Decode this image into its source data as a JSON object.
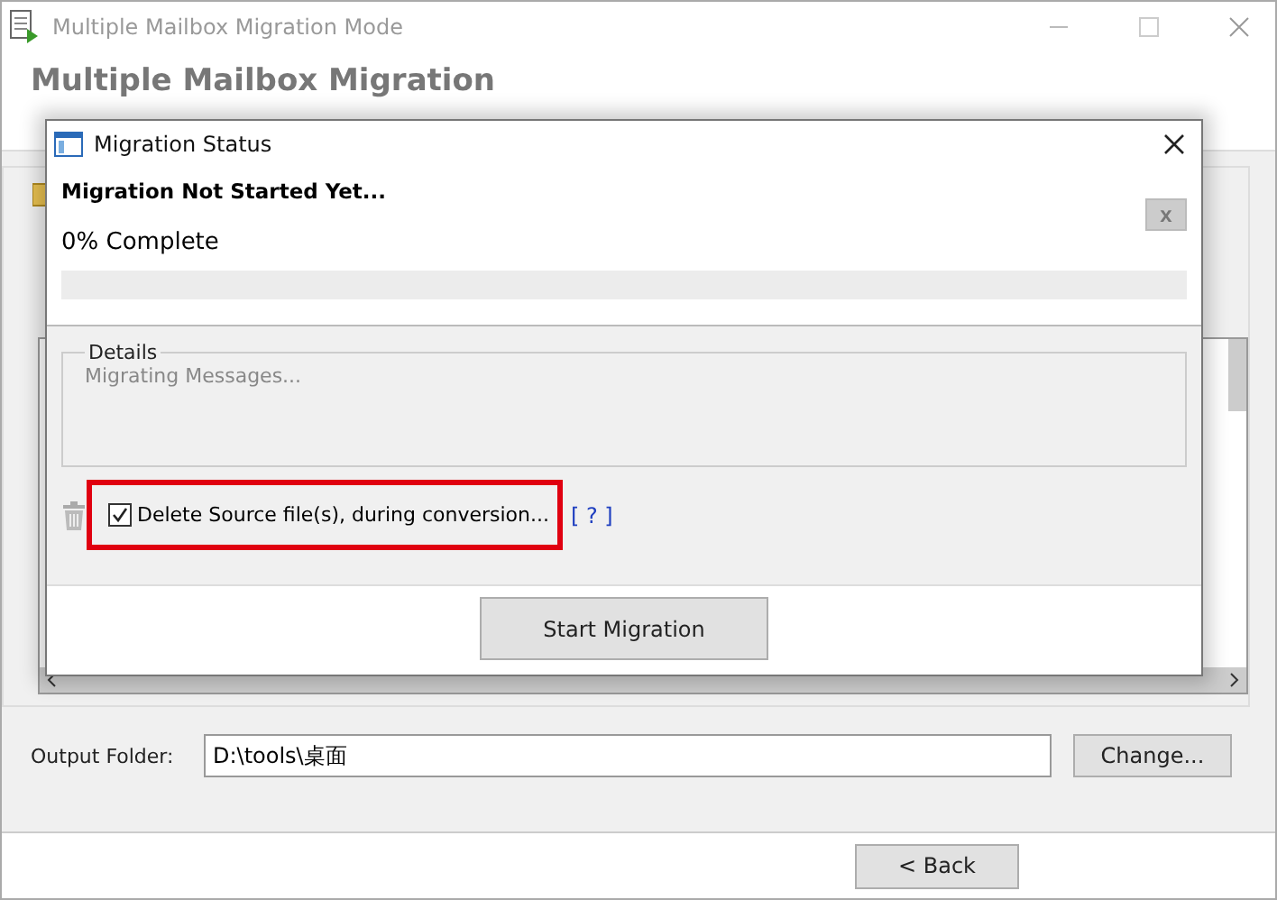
{
  "window": {
    "title": "Multiple Mailbox Migration Mode"
  },
  "header": {
    "title": "Multiple Mailbox Migration"
  },
  "output_folder": {
    "label": "Output Folder:",
    "value": "D:\\tools\\桌面",
    "button": "Change..."
  },
  "nav_buttons": [
    "< Back"
  ],
  "dialog": {
    "title": "Migration Status",
    "status": "Migration Not Started Yet...",
    "dismiss": "x",
    "progress_text": "0% Complete",
    "progress": {
      "level": 0
    },
    "details": {
      "legend": "Details",
      "text": "Migrating Messages..."
    },
    "delete_source": {
      "label": "Delete Source file(s), during conversion...",
      "checked": true,
      "highlighted": true
    },
    "help_link": "[ ? ]",
    "start_button": "Start Migration"
  }
}
